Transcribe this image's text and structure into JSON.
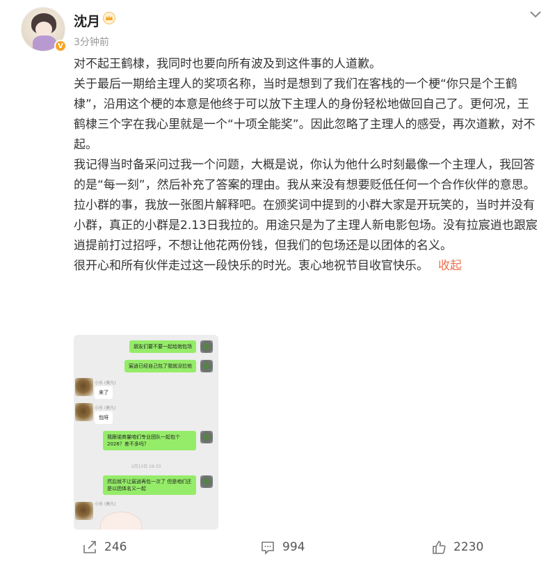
{
  "author": {
    "name": "沈月",
    "time": "3分钟前",
    "verified_badge": "V"
  },
  "post": {
    "paragraphs": [
      "对不起王鹤棣，我同时也要向所有波及到这件事的人道歉。",
      "关于最后一期给主理人的奖项名称，当时是想到了我们在客栈的一个梗“你只是个王鹤棣”，沿用这个梗的本意是他终于可以放下主理人的身份轻松地做回自己了。更何况，王鹤棣三个字在我心里就是一个“十项全能奖”。因此忽略了主理人的感受，再次道歉，对不起。",
      "我记得当时备采问过我一个问题，大概是说，你认为他什么时刻最像一个主理人，我回答的是“每一刻”，然后补充了答案的理由。我从来没有想要贬低任何一个合作伙伴的意思。",
      "拉小群的事，我放一张图片解释吧。在颁奖词中提到的小群大家是开玩笑的，当时并没有小群，真正的小群是2.13日我拉的。用途只是为了主理人新电影包场。没有拉宸逍也跟宸逍提前打过招呼，不想让他花两份钱，但我们的包场还是以团体的名义。",
      "很开心和所有伙伴走过这一段快乐的时光。衷心地祝节目收官快乐。"
    ],
    "collapse_label": "收起"
  },
  "chat_image": {
    "messages": {
      "m1": "朋友们要不要一起给她包场",
      "m2": "宸逍已经自己包了我就没拉他",
      "nick1": "小乐 (莫凡)",
      "m3": "来了",
      "nick2": "小乐 (莫凡)",
      "m4": "包呀",
      "m5": "我跟诺商量咱们专业团队一起包个2026？差不多吗？",
      "stamp": "2月13日 19:33",
      "m6": "然后就不让宸逍再包一次了 但是咱们还是以团体名义一起",
      "nick3": "小乐 (莫凡)"
    }
  },
  "actions": {
    "share_count": "246",
    "comment_count": "994",
    "like_count": "2230"
  },
  "colors": {
    "accent_link": "#eb7350",
    "chat_bubble_green": "#95ec69",
    "badge_orange": "#f5a623"
  }
}
